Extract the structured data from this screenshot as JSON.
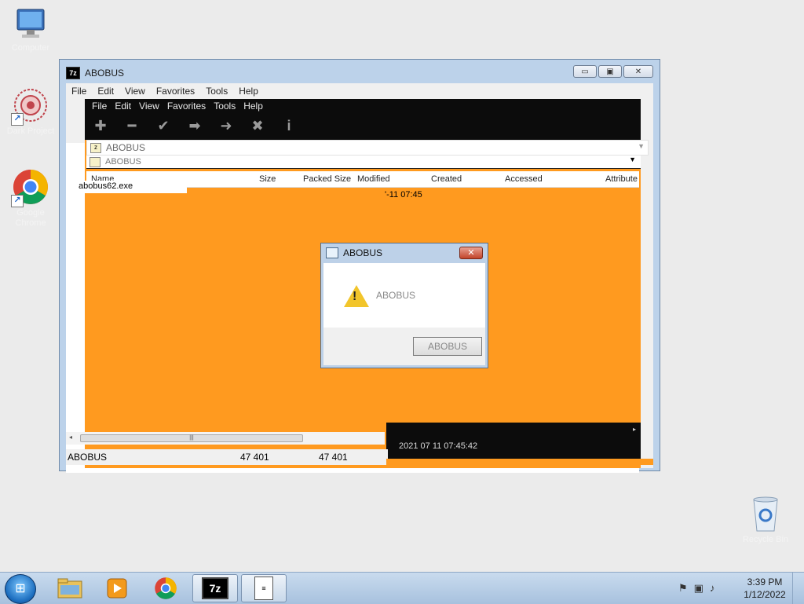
{
  "desktop": {
    "icons": [
      {
        "label": "Computer",
        "icon": "computer-icon"
      },
      {
        "label": "Dark Project",
        "icon": "sunburst-icon"
      },
      {
        "label": "Google Chrome",
        "icon": "chrome-icon"
      },
      {
        "label": "Recycle Bin",
        "icon": "recycle-bin-icon"
      }
    ]
  },
  "window": {
    "title": "ABOBUS",
    "logo": "7z",
    "menu": [
      "File",
      "Edit",
      "View",
      "Favorites",
      "Tools",
      "Help"
    ],
    "ghost_menu": [
      "File",
      "Edit",
      "View",
      "Favorites",
      "Tools",
      "Help"
    ],
    "toolbar_icons": [
      "add-icon",
      "extract-icon",
      "test-icon",
      "copy-icon",
      "move-icon",
      "delete-icon",
      "info-icon"
    ],
    "address": "ABOBUS",
    "ghost_address": "ABOBUS",
    "columns": [
      "Name",
      "Size",
      "Packed Size",
      "Modified",
      "Created",
      "Accessed",
      "Attribute"
    ],
    "file_name": "abobus62.exe",
    "date_fragment": "'-11 07:45",
    "timestamp": "2021 07 11 07:45:42",
    "scroll_grip": "|||",
    "status": {
      "label": "ABOBUS",
      "size": "47 401",
      "packed": "47 401"
    },
    "buttons": {
      "minimize": "▭",
      "maximize": "▣",
      "close": "✕"
    }
  },
  "dialog": {
    "title": "ABOBUS",
    "message": "ABOBUS",
    "button": "ABOBUS",
    "close": "✕"
  },
  "taskbar": {
    "items": [
      "explorer-icon",
      "media-player-icon",
      "chrome-icon",
      "7zip-icon",
      "document-icon"
    ],
    "tb_7z": "7z",
    "tb_doc": "≡",
    "time": "3:39 PM",
    "date": "1/12/2022"
  }
}
